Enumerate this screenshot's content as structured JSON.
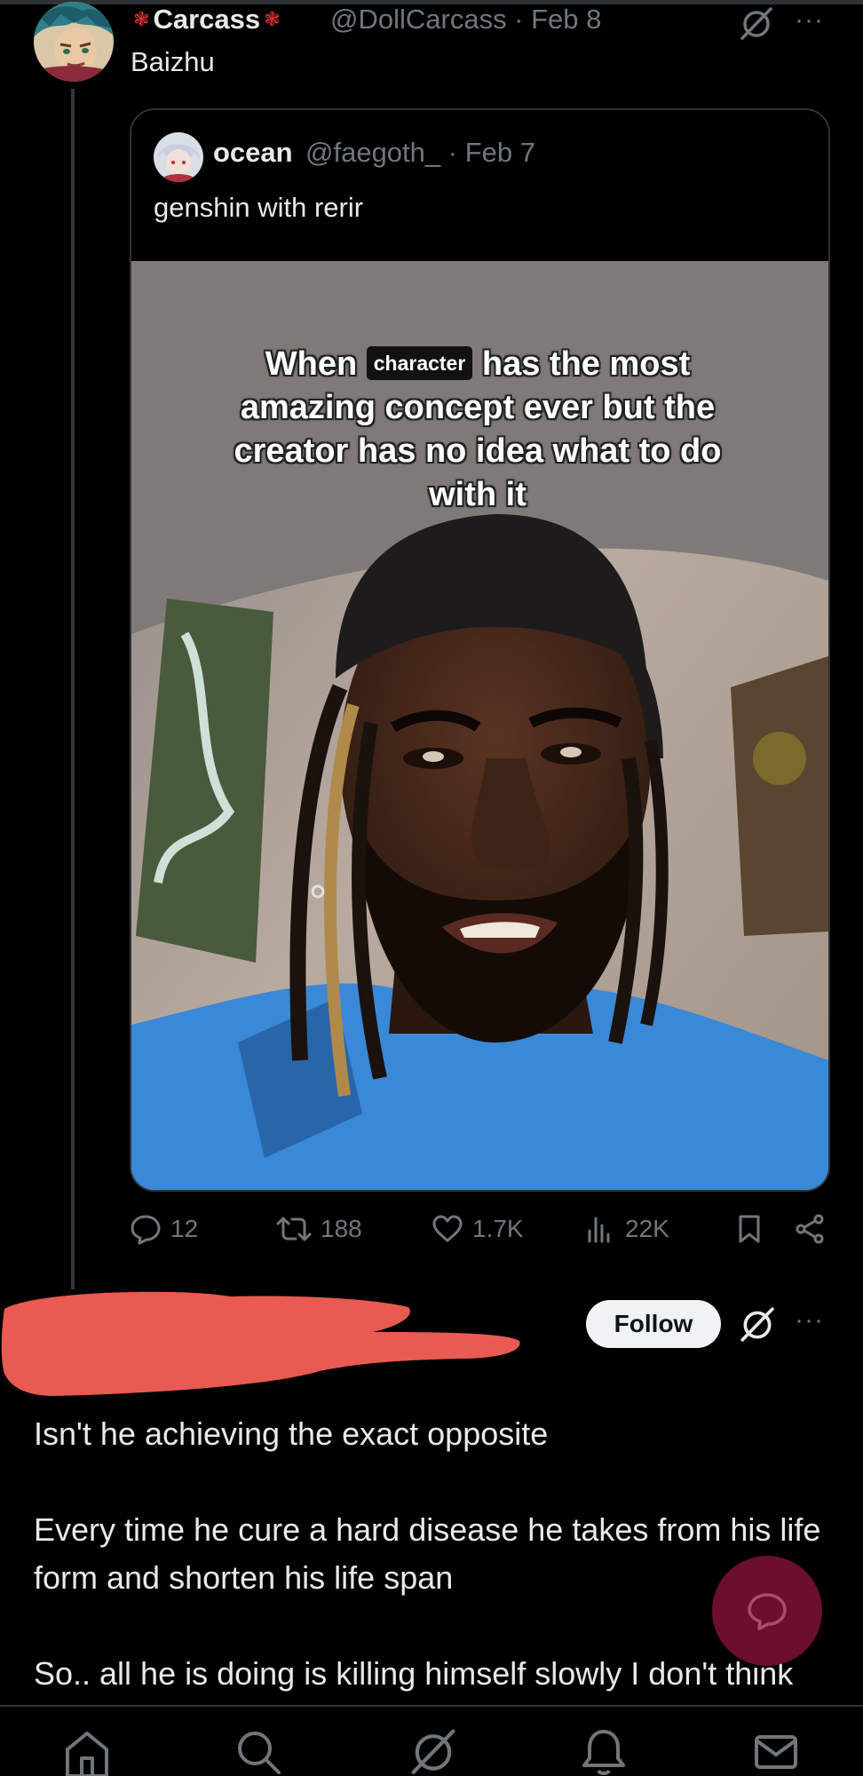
{
  "main_tweet": {
    "author_name": "Carcass",
    "handle_date": "@DollCarcass · Feb 8",
    "text": "Baizhu",
    "more": "···"
  },
  "quote_tweet": {
    "author_name": "ocean",
    "handle_date": "@faegoth_ · Feb 7",
    "text": "genshin with rerir",
    "caption": {
      "before": "When",
      "tag": "character",
      "after": "has the most amazing concept ever but the creator has no idea what to do with it"
    }
  },
  "actions": {
    "replies": "12",
    "reposts": "188",
    "likes": "1.7K",
    "views": "22K"
  },
  "reply_tweet": {
    "follow_label": "Follow",
    "more": "···",
    "paragraphs": [
      "Isn't he achieving the exact opposite",
      "Every time he cure a hard disease he takes from his life form and shorten his life span",
      "So.. all he is doing is killing himself slowly I don't think anyone important would worry about him..."
    ]
  },
  "icons": {
    "grok": "grok-icon",
    "reply": "reply-icon",
    "repost": "repost-icon",
    "like": "heart-icon",
    "views": "views-icon",
    "bookmark": "bookmark-icon",
    "share": "share-icon",
    "compose": "compose-icon",
    "nav": [
      "home-icon",
      "search-icon",
      "grok-icon",
      "notifications-icon",
      "messages-icon"
    ]
  },
  "colors": {
    "background": "#000000",
    "text": "#e7e9ea",
    "muted": "#71767b",
    "fab": "#6c0f2e",
    "redaction": "#e85a52"
  }
}
